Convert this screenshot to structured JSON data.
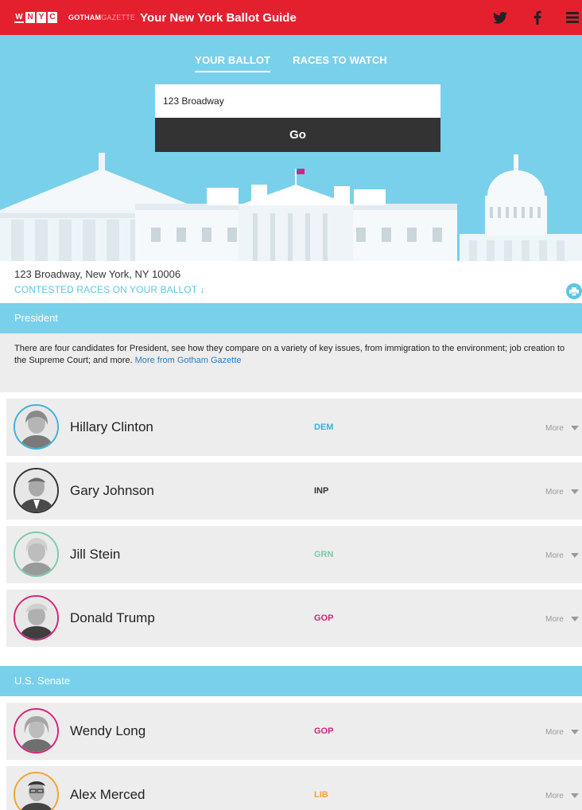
{
  "header": {
    "wnyc_letters": [
      "W",
      "N",
      "Y",
      "C"
    ],
    "gotham_bold": "GOTHAM",
    "gotham_light": "GAZETTE",
    "title": "Your New York Ballot Guide"
  },
  "tabs": [
    {
      "label": "YOUR BALLOT",
      "active": true
    },
    {
      "label": "RACES TO WATCH",
      "active": false
    }
  ],
  "search": {
    "value": "123 Broadway",
    "go_label": "Go"
  },
  "address": {
    "full": "123 Broadway, New York, NY 10006",
    "contested_label": "CONTESTED RACES ON YOUR BALLOT ↓"
  },
  "president": {
    "heading": "President",
    "description": "There are four candidates for President, see how they compare on a variety of key issues, from immigration to the environment; job creation to the Supreme Court; and more.",
    "link": "More from Gotham Gazette",
    "candidates": [
      {
        "name": "Hillary Clinton",
        "party": "DEM",
        "color": "#3db2d8",
        "more": "More"
      },
      {
        "name": "Gary Johnson",
        "party": "INP",
        "color": "#333333",
        "more": "More"
      },
      {
        "name": "Jill Stein",
        "party": "GRN",
        "color": "#7ccba7",
        "more": "More"
      },
      {
        "name": "Donald Trump",
        "party": "GOP",
        "color": "#d6237a",
        "more": "More"
      }
    ]
  },
  "senate": {
    "heading": "U.S. Senate",
    "candidates": [
      {
        "name": "Wendy Long",
        "party": "GOP",
        "color": "#d6237a",
        "more": "More"
      },
      {
        "name": "Alex Merced",
        "party": "LIB",
        "color": "#f2a232",
        "more": "More"
      }
    ]
  },
  "colors": {
    "brand_red": "#e4202f",
    "sky_blue": "#79d0ea",
    "link_blue": "#2f7dc1"
  }
}
